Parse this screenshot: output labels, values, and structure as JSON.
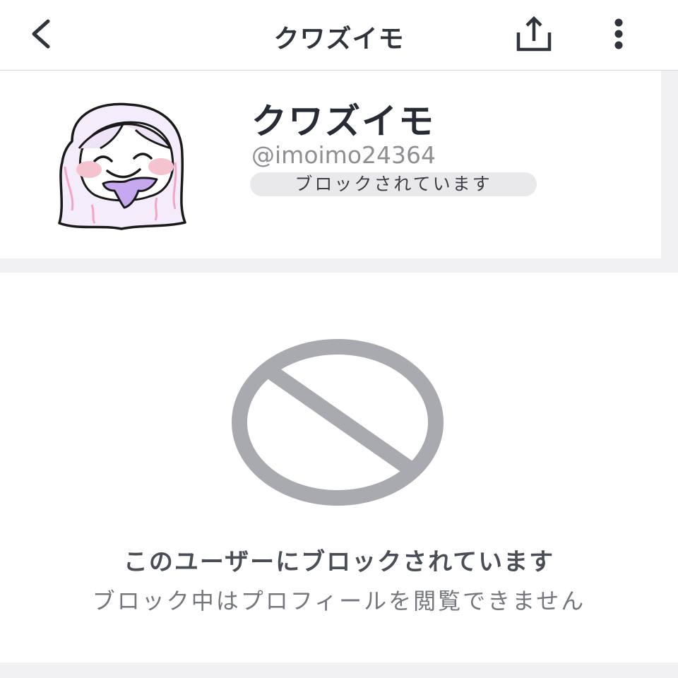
{
  "header": {
    "title": "クワズイモ",
    "back_icon": "chevron-left-icon",
    "share_icon": "share-icon",
    "more_icon": "more-vertical-icon"
  },
  "profile": {
    "display_name": "クワズイモ",
    "handle": "@imoimo24364",
    "status_badge": "ブロックされています"
  },
  "blocked_state": {
    "icon": "prohibited-icon",
    "message": "このユーザーにブロックされています",
    "sub_message": "ブロック中はプロフィールを閲覧できません"
  },
  "colors": {
    "title_text": "#262b36",
    "handle_text": "#8e8e93",
    "badge_bg": "#e9e9ec",
    "icon_gray": "#a9aaaf",
    "gap_bg": "#f1f1f3"
  }
}
